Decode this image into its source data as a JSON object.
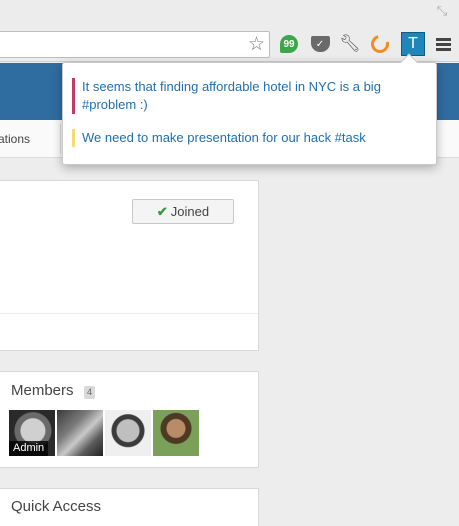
{
  "extensions": {
    "hangouts_symbol": "99",
    "tasks_letter": "T"
  },
  "subnav": {
    "item": "ations"
  },
  "joined": {
    "label": "Joined"
  },
  "members": {
    "title": "Members",
    "count": "4",
    "admin_label": "Admin"
  },
  "quick_access": {
    "title": "Quick Access"
  },
  "popup": {
    "notes": [
      {
        "text": "It seems that finding affordable hotel in NYC is a big #problem :)",
        "color": "#c53a64"
      },
      {
        "text": "We need to make presentation for our hack #task",
        "color": "#f2dc73"
      }
    ]
  },
  "colors": {
    "header": "#2f6ca0",
    "link": "#1f6fae",
    "tasks_icon": "#1e86b8"
  }
}
